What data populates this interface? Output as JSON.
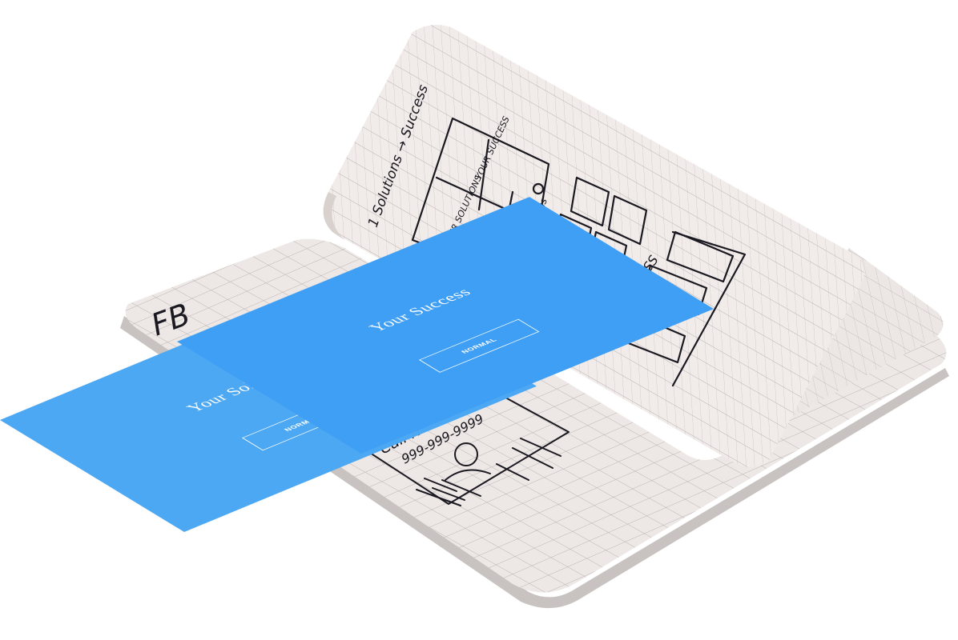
{
  "panels": {
    "left": {
      "title": "Your Solutions",
      "button_label": "NORMAL"
    },
    "right": {
      "title": "Your Success",
      "button_label": "NORMAL"
    }
  },
  "sketch": {
    "top_note": "1 Solutions → Success",
    "tile_left": "YOUR SOLUTIONS",
    "tile_right": "YOUR SUCCESS",
    "label_solutions": "Solutions",
    "label_success": "SUCCESS",
    "call_text": "Call Nikki!",
    "phone": "999-999-9999",
    "left_page_mark": "FB"
  }
}
